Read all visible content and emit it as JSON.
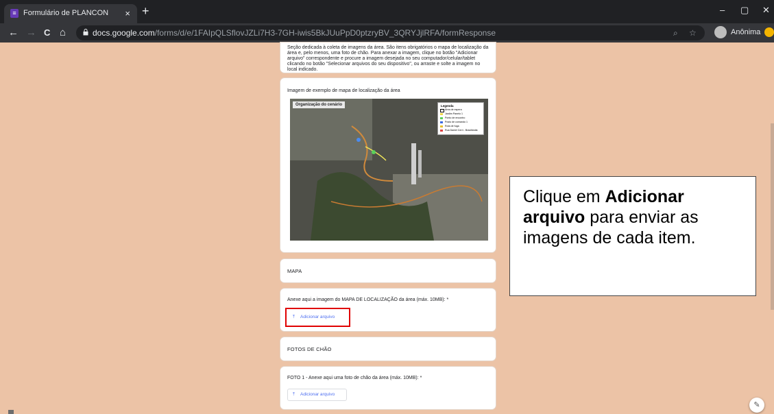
{
  "browser": {
    "tab_title": "Formulário de PLANCON",
    "tab_close": "×",
    "new_tab": "+",
    "url_host": "docs.google.com",
    "url_path": "/forms/d/e/1FAIpQLSflovJZLi7H3-7GH-iwis5BkJUuPpD0ptzryBV_3QRYJjlRFA/formResponse",
    "profile_label": "Anônima",
    "controls": {
      "minimize": "–",
      "maximize": "▢",
      "close": "✕"
    },
    "nav": {
      "back": "←",
      "forward": "→",
      "reload": "C",
      "home": "⌂"
    }
  },
  "form": {
    "section_description": "Seção dedicada à coleta de imagens da área. São itens obrigatórios o mapa de localização da área e, pelo menos, uma foto de chão. Para anexar a imagem, clique no botão \"Adicionar arquivo\" correspondente e procure a imagem desejada no seu computador/celular/tablet clicando no botão \"Selecionar arquivos do seu dispositivo\", ou arraste e solte a imagem no local indicado.",
    "example_title": "Imagem de exemplo de mapa de localização da área",
    "map": {
      "label": "Organização do cenário",
      "legend_title": "Legenda",
      "legend_items": [
        "Área de espera",
        "Jardim Panelo 1",
        "Ponto de encontro",
        "Posto de comando 1",
        "Rota de fuga",
        "Rua Daniel Cerri - Brasilândia"
      ]
    },
    "section_mapa": "MAPA",
    "q_mapa": "Anexe aqui a imagem do MAPA DE LOCALIZAÇÃO da área (máx. 10MB): *",
    "add_file_label": "Adicionar arquivo",
    "section_fotos": "FOTOS DE CHÃO",
    "q_foto1": "FOTO 1 - Anexe aqui uma foto de chão da área (máx. 10MB): *"
  },
  "callout": {
    "part1": "Clique em ",
    "bold1": "Adicionar arquivo",
    "part2": " para enviar as imagens de cada item."
  }
}
